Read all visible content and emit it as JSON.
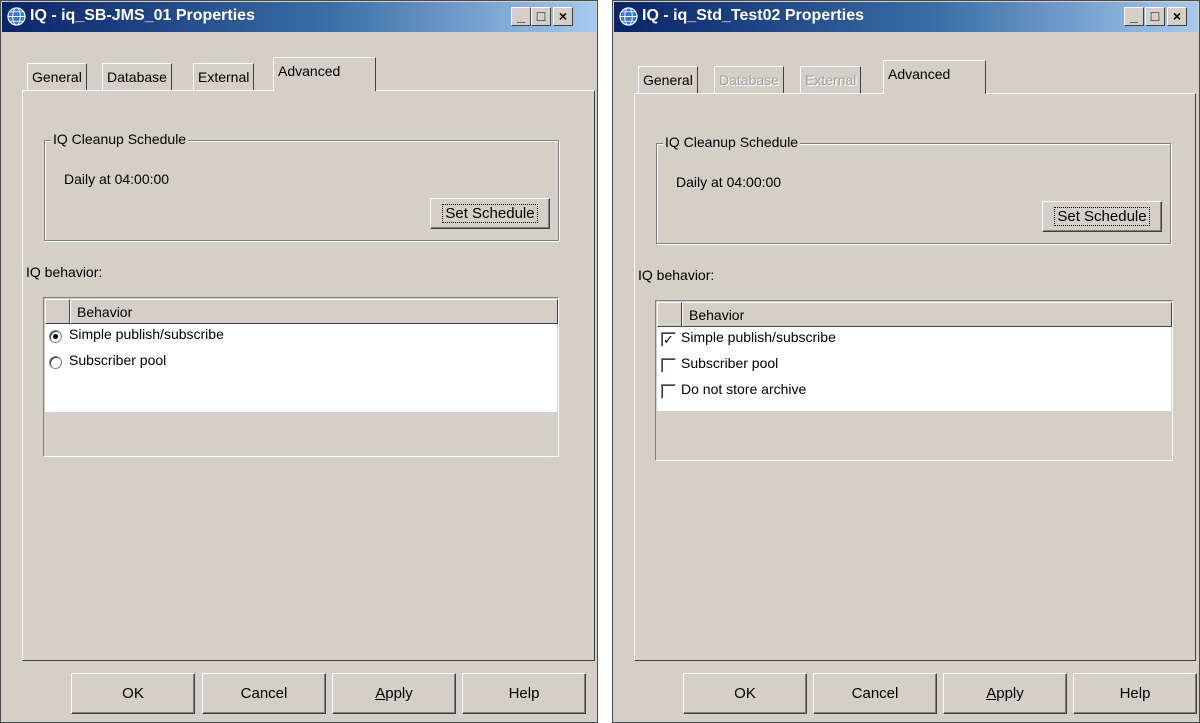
{
  "left_dialog": {
    "title": "IQ - iq_SB-JMS_01 Properties",
    "caption_buttons": {
      "minimize": "_",
      "maximize": "□",
      "close": "×"
    },
    "tabs": [
      {
        "label": "General",
        "state": "enabled"
      },
      {
        "label": "Database",
        "state": "enabled"
      },
      {
        "label": "External",
        "state": "enabled"
      },
      {
        "label": "Advanced",
        "state": "selected"
      }
    ],
    "cleanup": {
      "group_label": "IQ Cleanup Schedule",
      "schedule_text": "Daily at 04:00:00",
      "set_schedule_label": "Set Schedule"
    },
    "behavior_label": "IQ behavior:",
    "behavior_header": "Behavior",
    "behavior_control": "radio",
    "behavior_rows": [
      {
        "label": "Simple publish/subscribe",
        "selected": true
      },
      {
        "label": "Subscriber pool",
        "selected": false
      }
    ],
    "buttons": {
      "ok": "OK",
      "cancel": "Cancel",
      "apply_prefix": "A",
      "apply_rest": "pply",
      "help": "Help"
    }
  },
  "right_dialog": {
    "title": "IQ - iq_Std_Test02 Properties",
    "caption_buttons": {
      "minimize": "_",
      "maximize": "□",
      "close": "×"
    },
    "tabs": [
      {
        "label": "General",
        "state": "enabled"
      },
      {
        "label": "Database",
        "state": "disabled"
      },
      {
        "label": "External",
        "state": "disabled"
      },
      {
        "label": "Advanced",
        "state": "selected"
      }
    ],
    "cleanup": {
      "group_label": "IQ Cleanup Schedule",
      "schedule_text": "Daily at 04:00:00",
      "set_schedule_label": "Set Schedule"
    },
    "behavior_label": "IQ behavior:",
    "behavior_header": "Behavior",
    "behavior_control": "checkbox",
    "behavior_rows": [
      {
        "label": "Simple publish/subscribe",
        "checked": true
      },
      {
        "label": "Subscriber pool",
        "checked": false
      },
      {
        "label": "Do not store archive",
        "checked": false
      }
    ],
    "buttons": {
      "ok": "OK",
      "cancel": "Cancel",
      "apply_prefix": "A",
      "apply_rest": "pply",
      "help": "Help"
    }
  },
  "colors": {
    "dialog_face": "#d4d0c8",
    "titlebar_start": "#0a246a",
    "titlebar_end": "#a6caf0",
    "disabled_text": "#a0a0a0"
  }
}
